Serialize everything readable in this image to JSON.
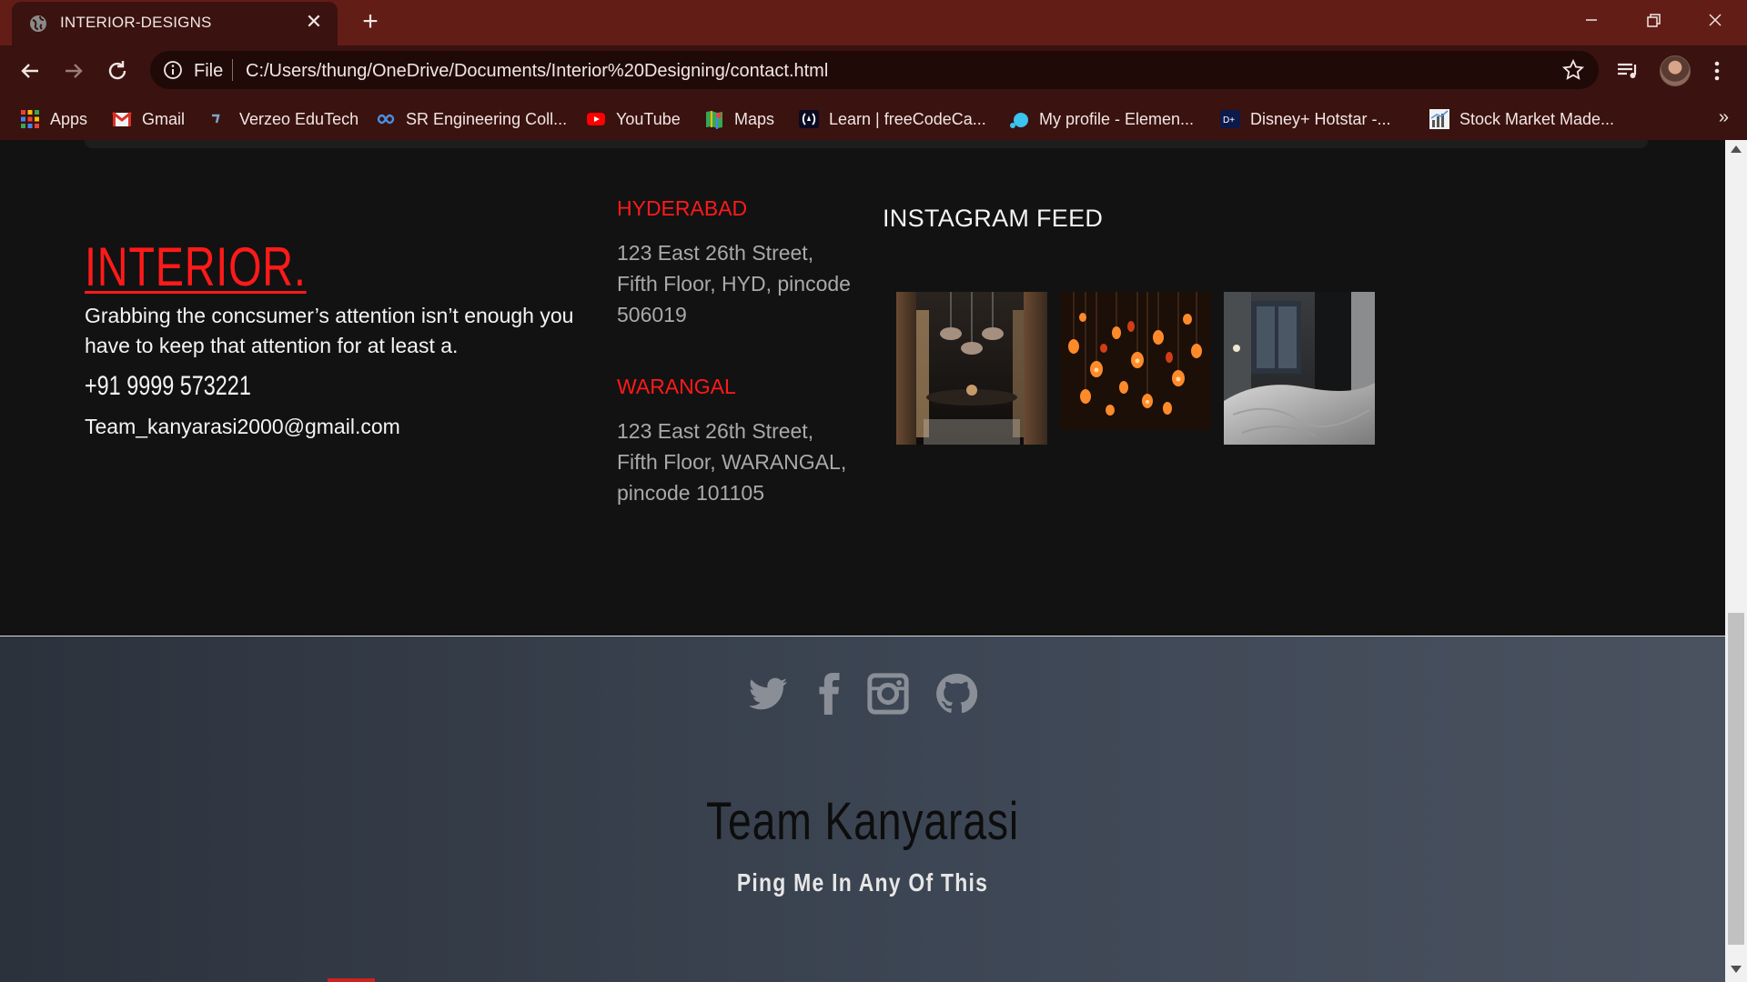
{
  "browser": {
    "tab_title": "INTERIOR-DESIGNS",
    "tab_close": "✕",
    "new_tab": "+",
    "scheme": "File",
    "url": "C:/Users/thung/OneDrive/Documents/Interior%20Designing/contact.html",
    "bookmarks": [
      {
        "label": "Apps",
        "icon": "apps-grid-icon"
      },
      {
        "label": "Gmail",
        "icon": "gmail-icon"
      },
      {
        "label": "Verzeo EduTech",
        "icon": "verzeo-icon"
      },
      {
        "label": "SR Engineering Coll...",
        "icon": "sr-engineering-icon"
      },
      {
        "label": "YouTube",
        "icon": "youtube-icon"
      },
      {
        "label": "Maps",
        "icon": "maps-icon"
      },
      {
        "label": "Learn | freeCodeCa...",
        "icon": "freecodecamp-icon"
      },
      {
        "label": "My profile - Elemen...",
        "icon": "element-icon"
      },
      {
        "label": "Disney+ Hotstar -...",
        "icon": "hotstar-icon"
      },
      {
        "label": "Stock Market Made...",
        "icon": "stock-chart-icon"
      }
    ],
    "more": "»",
    "accent_color": "#621d16"
  },
  "page": {
    "brand": "INTERIOR.",
    "about": "Grabbing the concsumer’s attention isn’t enough you have to keep that attention for at least a.",
    "phone": "+91 9999 573221",
    "email": "Team_kanyarasi2000@gmail.com",
    "locations": [
      {
        "city": "HYDERABAD",
        "address": "123 East 26th Street, Fifth Floor, HYD, pincode 506019"
      },
      {
        "city": "WARANGAL",
        "address": "123 East 26th Street, Fifth Floor, WARANGAL, pincode 101105"
      }
    ],
    "instagram_title": "INSTAGRAM FEED",
    "instagram_images": [
      "dining-room-pendant-lights",
      "hanging-bulb-lights",
      "dark-bedroom-interior"
    ],
    "accent_color": "#ff1a1a"
  },
  "footer": {
    "social_icons": [
      "twitter-icon",
      "facebook-icon",
      "instagram-icon",
      "github-icon"
    ],
    "team_name": "Team Kanyarasi",
    "tagline": "Ping Me In Any Of This"
  }
}
